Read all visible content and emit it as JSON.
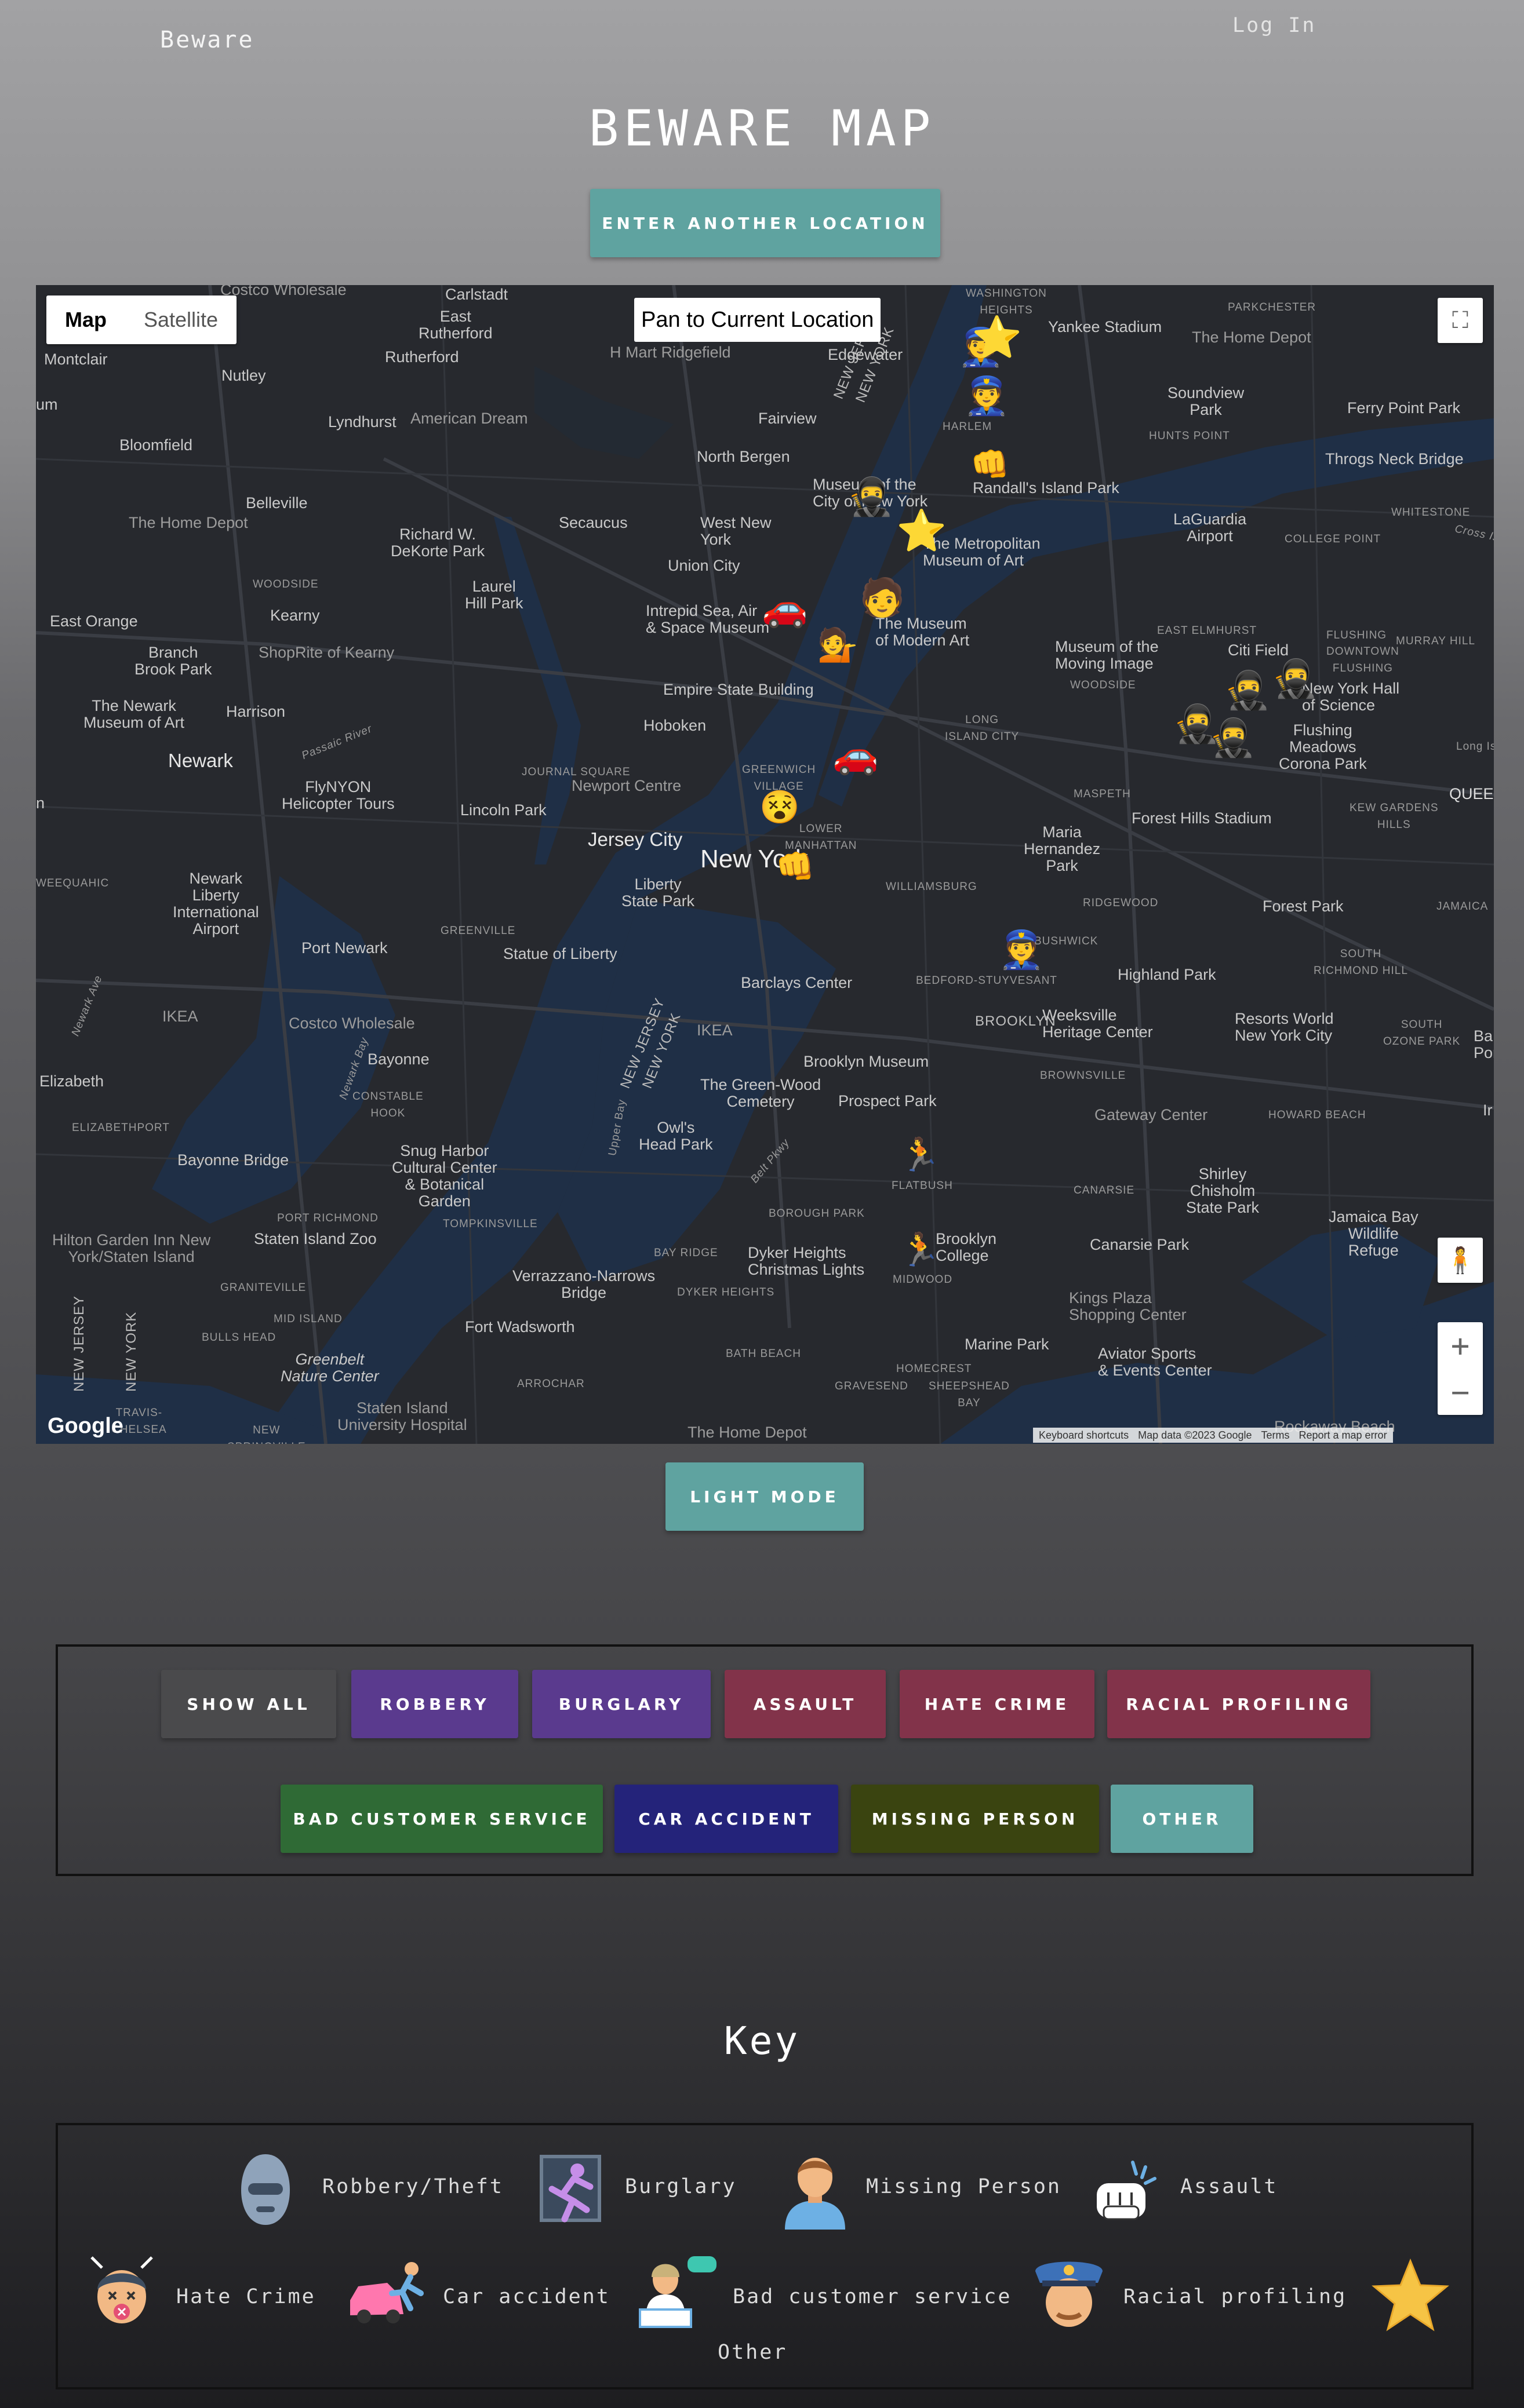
{
  "nav": {
    "brand": "Beware",
    "login": "Log In"
  },
  "page_title": "BEWARE MAP",
  "enter_location_label": "ENTER ANOTHER LOCATION",
  "light_mode_label": "LIGHT MODE",
  "map": {
    "type_map": "Map",
    "type_satellite": "Satellite",
    "pan_label": "Pan to Current Location",
    "google": "Google",
    "attribution": [
      "Keyboard shortcuts",
      "Map data ©2023 Google",
      "Terms",
      "Report a map error"
    ],
    "labels": {
      "new_york": "New York",
      "jersey_city": "Jersey City",
      "newark": "Newark",
      "brooklyn": "BROOKLYN",
      "hoboken": "Hoboken",
      "union_city": "Union City",
      "west_new_york": "West New\nYork",
      "north_bergen": "North Bergen",
      "secaucus": "Secaucus",
      "kearny": "Kearny",
      "harrison": "Harrison",
      "bayonne": "Bayonne",
      "elizabeth": "Elizabeth",
      "east_orange": "East Orange",
      "bloomfield": "Bloomfield",
      "belleville": "Belleville",
      "nutley": "Nutley",
      "montclair": "Montclair",
      "lyndhurst": "Lyndhurst",
      "rutherford": "Rutherford",
      "east_rutherford": "East\nRutherford",
      "carlstadt": "Carlstadt",
      "fairview": "Fairview",
      "edgewater": "Edgewater",
      "yankee_stadium": "Yankee Stadium",
      "soundview_park": "Soundview\nPark",
      "ferry_point_park": "Ferry Point Park",
      "throgs_neck_bridge": "Throgs Neck Bridge",
      "randalls_island": "Randall's Island Park",
      "laguardia": "LaGuardia\nAirport",
      "the_met": "The Metropolitan\nMuseum of Art",
      "moma": "The Museum\nof Modern Art",
      "museum_city_ny": "Museum of the\nCity of New York",
      "intrepid": "Intrepid Sea, Air\n& Space Museum",
      "empire_state": "Empire State Building",
      "citi_field": "Citi Field",
      "ny_hall_science": "New York Hall\nof Science",
      "flushing_meadows": "Flushing\nMeadows\nCorona Park",
      "forest_hills": "Forest Hills Stadium",
      "maria_hernandez": "Maria\nHernandez\nPark",
      "forest_park": "Forest Park",
      "highland_park": "Highland Park",
      "weeksville": "Weeksville\nHeritage Center",
      "resorts_world": "Resorts World\nNew York City",
      "barclays": "Barclays Center",
      "brooklyn_museum": "Brooklyn Museum",
      "prospect_park": "Prospect Park",
      "green_wood": "The Green-Wood\nCemetery",
      "owls_head": "Owl's\nHead Park",
      "gateway": "Gateway Center",
      "shirley_chisholm": "Shirley\nChisholm\nState Park",
      "jamaica_bay": "Jamaica Bay\nWildlife\nRefuge",
      "canarsie_park": "Canarsie Park",
      "kings_plaza": "Kings Plaza\nShopping Center",
      "marine_park": "Marine Park",
      "aviator": "Aviator Sports\n& Events Center",
      "dyker": "Dyker Heights\nChristmas Lights",
      "verrazzano": "Verrazzano-Narrows\nBridge",
      "fort_wadsworth": "Fort Wadsworth",
      "staten_island_zoo": "Staten Island Zoo",
      "snug_harbor": "Snug Harbor\nCultural Center\n& Botanical\nGarden",
      "bayonne_bridge": "Bayonne Bridge",
      "greenbelt": "Greenbelt\nNature Center",
      "statue_liberty": "Statue of Liberty",
      "liberty_state_park": "Liberty\nState Park",
      "port_newark": "Port Newark",
      "lincoln_park": "Lincoln Park",
      "flynyon": "FlyNYON\nHelicopter Tours",
      "newark_airport": "Newark\nLiberty\nInternational\nAirport",
      "newark_museum": "The Newark\nMuseum of Art",
      "branch_brook": "Branch\nBrook Park",
      "laurel_hill": "Laurel\nHill Park",
      "richard_dekorte": "Richard W.\nDeKorte Park",
      "museum_moving_image": "Museum of the\nMoving Image",
      "brooklyn_college": "Brooklyn\nCollege",
      "home_depot_1": "The Home Depot",
      "home_depot_2": "The Home Depot",
      "costco_1": "Costco Wholesale",
      "costco_2": "Costco Wholesale",
      "ikea_1": "IKEA",
      "ikea_2": "IKEA",
      "american_dream": "American Dream",
      "shoprite": "ShopRite of Kearny",
      "hmart": "H Mart Ridgefield",
      "newport_centre": "Newport Centre",
      "hilton_garden": "Hilton Garden Inn New\nYork/Staten Island",
      "staten_island_uh": "Staten Island\nUniversity Hospital",
      "rockaway": "Rockaway Beach",
      "lower_manhattan": "LOWER\nMANHATTAN",
      "greenwich_village": "GREENWICH\nVILLAGE",
      "williamsburg": "WILLIAMSBURG",
      "bushwick": "BUSHWICK",
      "bed_stuy": "BEDFORD-STUYVESANT",
      "flatbush": "FLATBUSH",
      "midwood": "MIDWOOD",
      "bay_ridge": "BAY RIDGE",
      "dyker_heights": "DYKER HEIGHTS",
      "borough_park": "BOROUGH PARK",
      "bath_beach": "BATH BEACH",
      "gravesend": "GRAVESEND",
      "homecrest": "HOMECREST",
      "sheepshead_bay": "SHEEPSHEAD\nBAY",
      "canarsie": "CANARSIE",
      "brownsville": "BROWNSVILLE",
      "ridgewood": "RIDGEWOOD",
      "maspeth": "MASPETH",
      "woodside": "WOODSIDE",
      "long_island_city": "LONG\nISLAND CITY",
      "east_elmhurst": "EAST ELMHURST",
      "flushing": "FLUSHING",
      "harlem": "HARLEM",
      "parkchester": "PARKCHESTER",
      "hunts_point": "HUNTS POINT",
      "whitestone": "WHITESTONE",
      "college_point": "COLLEGE POINT",
      "murray_hill": "MURRAY HILL",
      "kew_gardens": "KEW GARDENS\nHILLS",
      "jamaica": "JAMAICA",
      "south_richmond_hill": "SOUTH\nRICHMOND HILL",
      "south_ozone_park": "SOUTH\nOZONE PARK",
      "howard_beach": "HOWARD BEACH",
      "queens": "QUEEN",
      "woodside_nj": "WOODSIDE",
      "constable_hook": "CONSTABLE\nHOOK",
      "elizabethport": "ELIZABETHPORT",
      "port_richmond": "PORT RICHMOND",
      "tompkinsville": "TOMPKINSVILLE",
      "graniteville": "GRANITEVILLE",
      "mid_island": "MID ISLAND",
      "bulls_head": "BULLS HEAD",
      "arrochar": "ARROCHAR",
      "travis": "TRAVIS-\nCHELSEA",
      "new_springville": "NEW\nSPRINGVILLE",
      "greenville": "GREENVILLE",
      "journal_square": "JOURNAL SQUARE",
      "weequahic": "WEEQUAHIC",
      "downtown_flushing": "DOWNTOWN\nFLUSHING",
      "new_jersey": "NEW JERSEY",
      "new_york_state": "NEW YORK",
      "washington_heights": "WASHINGTON\nHEIGHTS",
      "cross_island": "Cross Island Pkwy",
      "upper_bay": "Upper Bay",
      "belt_pkwy": "Belt Pkwy",
      "passaic_river": "Passaic River",
      "newark_bay": "Newark Bay",
      "newark_ave": "Newark Ave",
      "long_isl": "Long Isl",
      "um": "um",
      "n": "n",
      "ba": "Ba\nPor",
      "ir": "Ir"
    }
  },
  "filters": {
    "row1": [
      {
        "label": "SHOW ALL",
        "color": "#4a4a4c"
      },
      {
        "label": "ROBBERY",
        "color": "#5a3a8e"
      },
      {
        "label": "BURGLARY",
        "color": "#5a3a8e"
      },
      {
        "label": "ASSAULT",
        "color": "#82334a"
      },
      {
        "label": "HATE CRIME",
        "color": "#82334a"
      },
      {
        "label": "RACIAL PROFILING",
        "color": "#82334a"
      }
    ],
    "row2": [
      {
        "label": "BAD CUSTOMER SERVICE",
        "color": "#2f6a35"
      },
      {
        "label": "CAR ACCIDENT",
        "color": "#24237a"
      },
      {
        "label": "MISSING PERSON",
        "color": "#3a4410"
      },
      {
        "label": "OTHER",
        "color": "#5fa3a0"
      }
    ]
  },
  "key": {
    "title": "Key",
    "robbery": "Robbery/Theft",
    "burglary": "Burglary",
    "missing": "Missing Person",
    "assault": "Assault",
    "hate": "Hate Crime",
    "car": "Car accident",
    "bad_service": "Bad customer service",
    "racial": "Racial profiling",
    "other": "Other"
  }
}
